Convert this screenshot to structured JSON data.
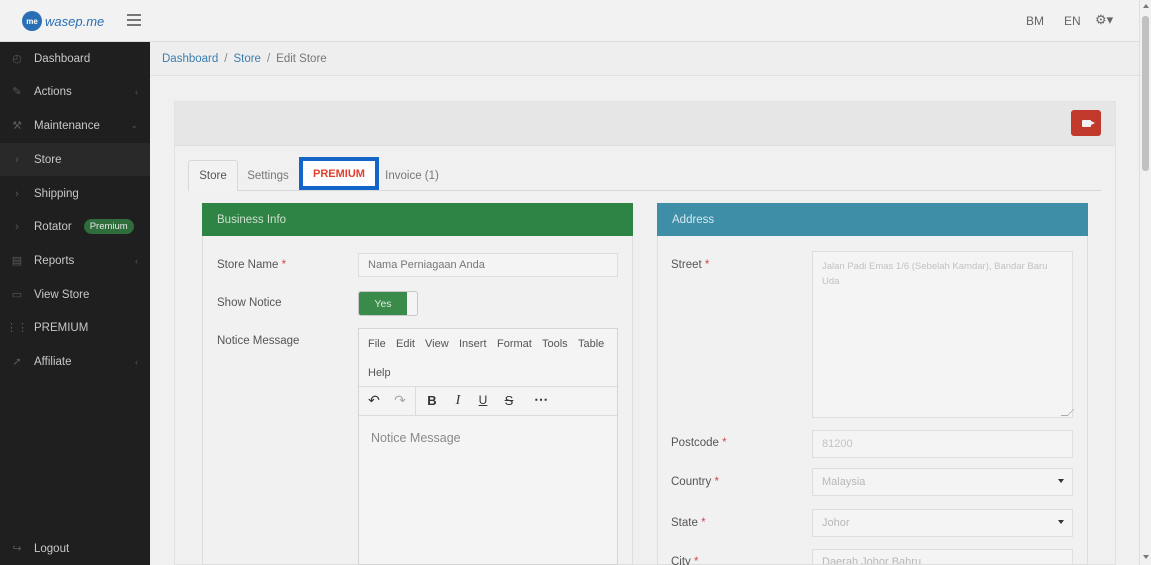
{
  "header": {
    "logo_mark": "me",
    "logo_text": "wasep.me",
    "lang_bm": "BM",
    "lang_en": "EN",
    "settings_icon": "gear-icon"
  },
  "sidebar": {
    "items": [
      {
        "label": "Dashboard",
        "icon": "dashboard-icon"
      },
      {
        "label": "Actions",
        "icon": "pencil-icon"
      },
      {
        "label": "Maintenance",
        "icon": "wrench-icon"
      },
      {
        "label": "Store",
        "icon": "chevron-right-icon"
      },
      {
        "label": "Shipping",
        "icon": "chevron-right-icon"
      },
      {
        "label": "Rotator",
        "icon": "chevron-right-icon",
        "badge": "Premium"
      },
      {
        "label": "Reports",
        "icon": "reports-icon"
      },
      {
        "label": "View Store",
        "icon": "monitor-icon"
      },
      {
        "label": "PREMIUM",
        "icon": "sliders-icon"
      },
      {
        "label": "Affiliate",
        "icon": "rocket-icon"
      }
    ],
    "logout": "Logout"
  },
  "breadcrumb": {
    "dashboard": "Dashboard",
    "store": "Store",
    "current": "Edit Store",
    "separator": "/"
  },
  "tabs": {
    "store": "Store",
    "settings": "Settings",
    "premium": "PREMIUM",
    "invoice": "Invoice (1)"
  },
  "business": {
    "title": "Business Info",
    "store_name_label": "Store Name",
    "store_name_value": "Nama Perniagaan Anda",
    "show_notice_label": "Show Notice",
    "show_notice_value": "Yes",
    "notice_message_label": "Notice Message",
    "editor": {
      "menu": [
        "File",
        "Edit",
        "View",
        "Insert",
        "Format",
        "Tools",
        "Table",
        "Help"
      ],
      "placeholder": "Notice Message"
    }
  },
  "address": {
    "title": "Address",
    "street_label": "Street",
    "street_value": "Jalan Padi Emas 1/6 (Sebelah Kamdar), Bandar Baru Uda",
    "postcode_label": "Postcode",
    "postcode_value": "81200",
    "country_label": "Country",
    "country_value": "Malaysia",
    "state_label": "State",
    "state_value": "Johor",
    "city_label": "City",
    "city_value": "Daerah Johor Bahru"
  },
  "required_mark": "*",
  "colors": {
    "business_header": "#2e8444",
    "address_header": "#3f8ea8",
    "premium_tab_border": "#1366c8",
    "premium_tab_text": "#e23e2b",
    "record_button": "#c0392b"
  }
}
